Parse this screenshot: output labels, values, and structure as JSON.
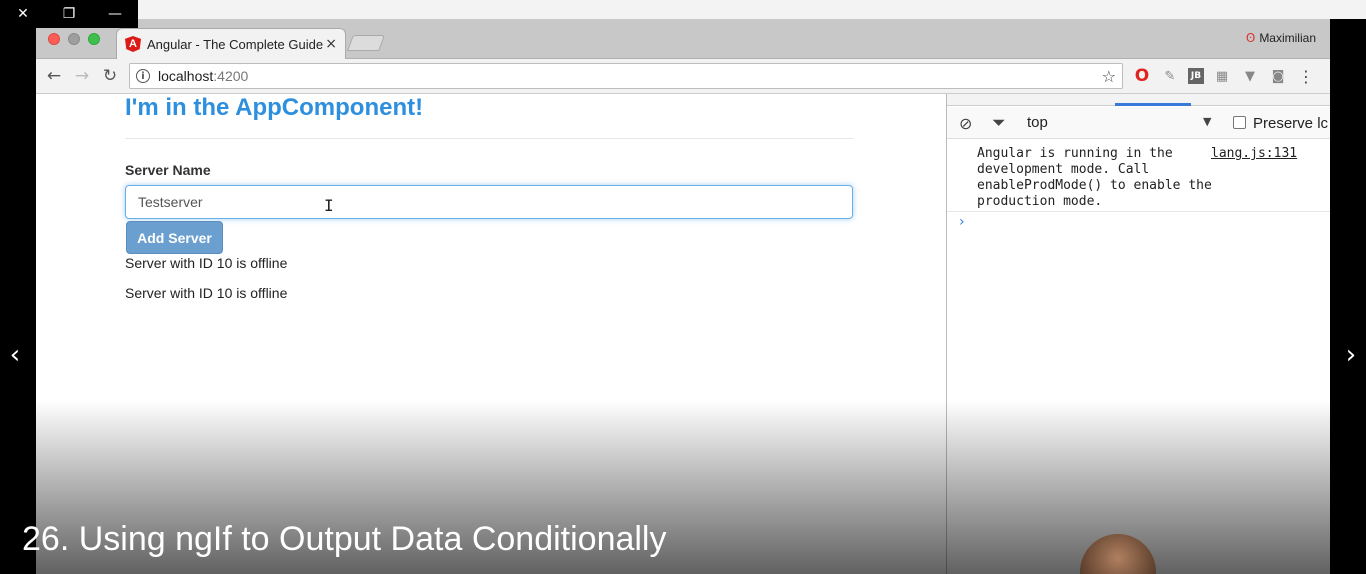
{
  "window_controls": {
    "close": "✕",
    "restore": "❐",
    "minimize": "—"
  },
  "nav": {
    "prev": "‹",
    "next": "›"
  },
  "browser": {
    "tab": {
      "title": "Angular - The Complete Guide",
      "favicon": "A",
      "close": "×"
    },
    "profile": {
      "name": "Maximilian",
      "icon": "ʘ"
    },
    "toolbar": {
      "back": "←",
      "forward": "→",
      "reload": "↻",
      "url_host": "localhost",
      "url_port": ":4200",
      "info": "i",
      "star": "☆"
    },
    "extensions": [
      "opera-icon",
      "eyedropper-icon",
      "jetbrains-icon",
      "grid-icon",
      "vue-icon",
      "cast-icon",
      "menu-icon"
    ],
    "extension_glyphs": {
      "opera": "O",
      "eyedropper": "✎",
      "jb": "JB",
      "grid": "▦",
      "vue": "▼",
      "cast": "◙",
      "menu": "⋮"
    }
  },
  "page": {
    "heading": "I'm in the AppComponent!",
    "server_name_label": "Server Name",
    "server_name_value": "Testserver",
    "add_server_label": "Add Server",
    "status_lines": [
      "Server with ID 10 is offline",
      "Server with ID 10 is offline"
    ]
  },
  "devtools": {
    "context": "top",
    "preserve_log": "Preserve lc",
    "log_message": "Angular is running in the\ndevelopment mode. Call\nenableProdMode() to enable the\nproduction mode.",
    "log_source": "lang.js:131",
    "prompt": "›"
  },
  "caption": "26. Using ngIf to Output Data Conditionally",
  "colors": {
    "heading": "#2d8fde",
    "button": "#6b9fd0",
    "input_focus": "#66afe9"
  }
}
